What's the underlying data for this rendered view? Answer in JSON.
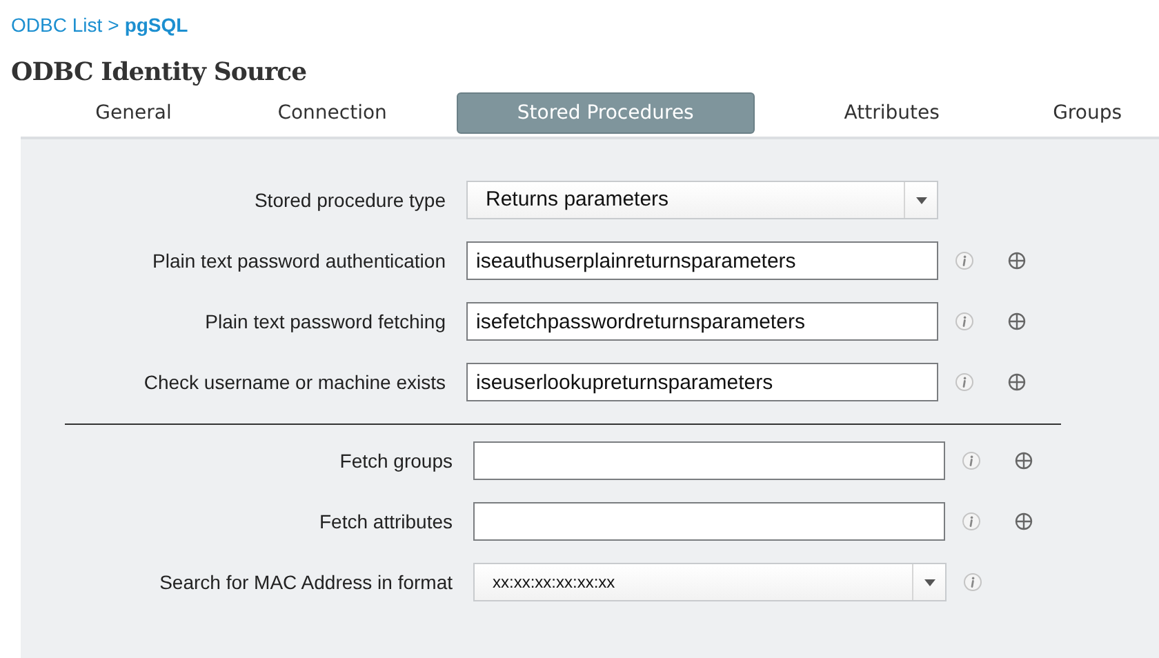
{
  "breadcrumb": {
    "parent": "ODBC List",
    "separator": ">",
    "current": "pgSQL"
  },
  "title": "ODBC Identity Source",
  "tabs": [
    {
      "label": "General",
      "selected": false
    },
    {
      "label": "Connection",
      "selected": false
    },
    {
      "label": "Stored Procedures",
      "selected": true
    },
    {
      "label": "Attributes",
      "selected": false
    },
    {
      "label": "Groups",
      "selected": false
    }
  ],
  "groups": [
    {
      "rows": [
        {
          "kind": "select",
          "label": "Stored procedure type",
          "value": "Returns parameters",
          "info": false,
          "browse": false
        },
        {
          "kind": "text",
          "label": "Plain text password authentication",
          "value": "iseauthuserplainreturnsparameters",
          "info": true,
          "browse": true
        },
        {
          "kind": "text",
          "label": "Plain text password fetching",
          "value": "isefetchpasswordreturnsparameters",
          "info": true,
          "browse": true
        },
        {
          "kind": "text",
          "label": "Check username or machine exists",
          "value": "iseuserlookupreturnsparameters",
          "info": true,
          "browse": true
        }
      ]
    },
    {
      "rows": [
        {
          "kind": "text",
          "label": "Fetch groups",
          "info": true,
          "browse": true
        },
        {
          "kind": "text",
          "label": "Fetch attributes",
          "info": true,
          "browse": true
        },
        {
          "kind": "select",
          "label": "Search for MAC Address in format",
          "value": "xx:xx:xx:xx:xx:xx",
          "info": true,
          "browse": false
        }
      ]
    }
  ]
}
